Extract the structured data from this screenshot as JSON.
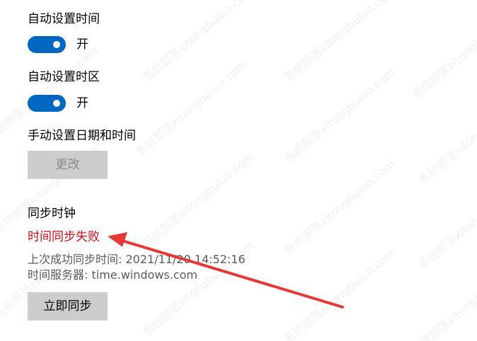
{
  "auto_time": {
    "label": "自动设置时间",
    "state": "开",
    "on": true
  },
  "auto_timezone": {
    "label": "自动设置时区",
    "state": "开",
    "on": true
  },
  "manual": {
    "label": "手动设置日期和时间",
    "change_button": "更改"
  },
  "sync": {
    "heading": "同步时钟",
    "status": "时间同步失败",
    "last_success": "上次成功同步时间: 2021/11/20 14:52:16",
    "server": "时间服务器: time.windows.com",
    "sync_button": "立即同步"
  },
  "watermark": {
    "text": "系统部落xitongbuluo.com"
  },
  "colors": {
    "accent": "#0067c0",
    "error": "#c50f1f",
    "arrow": "#e53935",
    "button_bg": "#cccccc"
  }
}
